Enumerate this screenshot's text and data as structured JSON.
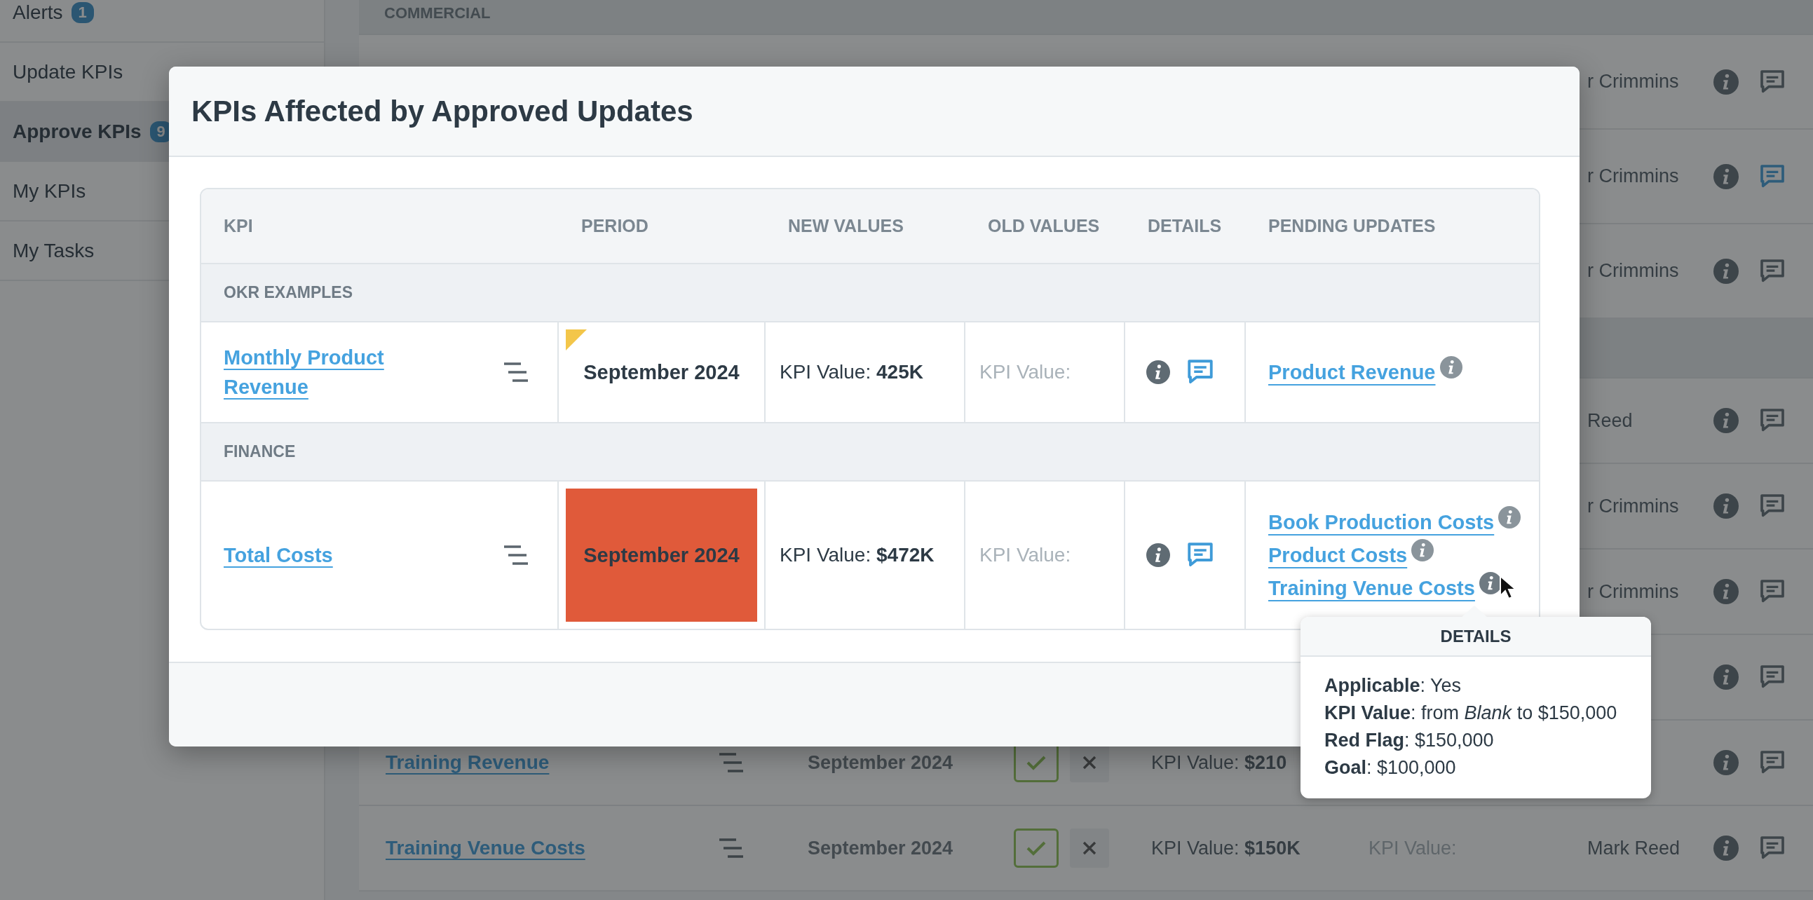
{
  "sidebar": {
    "items": [
      {
        "label": "Alerts",
        "badge": "1",
        "selected": false
      },
      {
        "label": "Update KPIs",
        "selected": false
      },
      {
        "label": "Approve KPIs",
        "badge": "9",
        "selected": true
      },
      {
        "label": "My KPIs",
        "selected": false
      },
      {
        "label": "My Tasks",
        "selected": false
      }
    ]
  },
  "background_table": {
    "rows": [
      {
        "kind": "group",
        "label": "COMMERCIAL"
      },
      {
        "kind": "kpi",
        "owner": "r Crimmins",
        "comment_active": false
      },
      {
        "kind": "kpi",
        "owner": "r Crimmins",
        "comment_active": true
      },
      {
        "kind": "kpi",
        "owner": "r Crimmins",
        "comment_active": false
      },
      {
        "kind": "group"
      },
      {
        "kind": "kpi",
        "owner": "Reed",
        "comment_active": false
      },
      {
        "kind": "kpi",
        "owner": "r Crimmins",
        "comment_active": false
      },
      {
        "kind": "kpi",
        "owner": "r Crimmins",
        "comment_active": false
      },
      {
        "kind": "kpi",
        "comment_active": false
      },
      {
        "kind": "kpi",
        "name": "Training Revenue",
        "period": "September 2024",
        "actions": true,
        "new_value": "KPI Value: **$210**",
        "comment_active": false
      },
      {
        "kind": "kpi",
        "name": "Training Venue Costs",
        "period": "September 2024",
        "actions": true,
        "new_value": "KPI Value: **$150K**",
        "old_value": "KPI Value:",
        "owner": "Mark Reed",
        "comment_active": false
      }
    ]
  },
  "modal": {
    "title": "KPIs Affected by Approved Updates",
    "columns": [
      "KPI",
      "PERIOD",
      "NEW VALUES",
      "OLD VALUES",
      "DETAILS",
      "PENDING UPDATES"
    ],
    "groups": [
      {
        "label": "OKR EXAMPLES",
        "rows": [
          {
            "kpi": "Monthly Product Revenue",
            "period": "September 2024",
            "flagged": true,
            "red_flag": false,
            "new_value": "KPI Value: **425K**",
            "old_value": "KPI Value:",
            "updates": [
              {
                "label": "Product Revenue",
                "hovered": false
              }
            ]
          }
        ]
      },
      {
        "label": "FINANCE",
        "rows": [
          {
            "kpi": "Total Costs",
            "period": "September 2024",
            "flagged": false,
            "red_flag": true,
            "new_value": "KPI Value: **$472K**",
            "old_value": "KPI Value:",
            "updates": [
              {
                "label": "Book Production Costs",
                "hovered": false
              },
              {
                "label": "Product Costs",
                "hovered": false
              },
              {
                "label": "Training Venue Costs",
                "hovered": true
              }
            ]
          }
        ]
      }
    ]
  },
  "tooltip": {
    "title": "DETAILS",
    "lines": [
      "**Applicable**: Yes",
      "**KPI Value**: from *Blank* to $150,000",
      "**Red Flag**: $150,000",
      "**Goal**: $100,000"
    ]
  }
}
